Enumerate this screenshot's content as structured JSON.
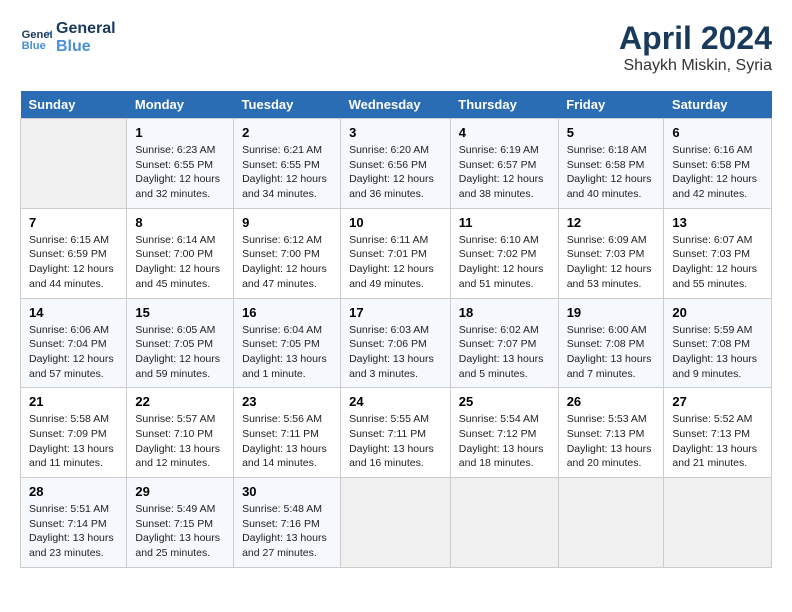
{
  "header": {
    "logo_line1": "General",
    "logo_line2": "Blue",
    "main_title": "April 2024",
    "subtitle": "Shaykh Miskin, Syria"
  },
  "calendar": {
    "weekdays": [
      "Sunday",
      "Monday",
      "Tuesday",
      "Wednesday",
      "Thursday",
      "Friday",
      "Saturday"
    ],
    "weeks": [
      [
        {
          "day": "",
          "info": ""
        },
        {
          "day": "1",
          "info": "Sunrise: 6:23 AM\nSunset: 6:55 PM\nDaylight: 12 hours\nand 32 minutes."
        },
        {
          "day": "2",
          "info": "Sunrise: 6:21 AM\nSunset: 6:55 PM\nDaylight: 12 hours\nand 34 minutes."
        },
        {
          "day": "3",
          "info": "Sunrise: 6:20 AM\nSunset: 6:56 PM\nDaylight: 12 hours\nand 36 minutes."
        },
        {
          "day": "4",
          "info": "Sunrise: 6:19 AM\nSunset: 6:57 PM\nDaylight: 12 hours\nand 38 minutes."
        },
        {
          "day": "5",
          "info": "Sunrise: 6:18 AM\nSunset: 6:58 PM\nDaylight: 12 hours\nand 40 minutes."
        },
        {
          "day": "6",
          "info": "Sunrise: 6:16 AM\nSunset: 6:58 PM\nDaylight: 12 hours\nand 42 minutes."
        }
      ],
      [
        {
          "day": "7",
          "info": "Sunrise: 6:15 AM\nSunset: 6:59 PM\nDaylight: 12 hours\nand 44 minutes."
        },
        {
          "day": "8",
          "info": "Sunrise: 6:14 AM\nSunset: 7:00 PM\nDaylight: 12 hours\nand 45 minutes."
        },
        {
          "day": "9",
          "info": "Sunrise: 6:12 AM\nSunset: 7:00 PM\nDaylight: 12 hours\nand 47 minutes."
        },
        {
          "day": "10",
          "info": "Sunrise: 6:11 AM\nSunset: 7:01 PM\nDaylight: 12 hours\nand 49 minutes."
        },
        {
          "day": "11",
          "info": "Sunrise: 6:10 AM\nSunset: 7:02 PM\nDaylight: 12 hours\nand 51 minutes."
        },
        {
          "day": "12",
          "info": "Sunrise: 6:09 AM\nSunset: 7:03 PM\nDaylight: 12 hours\nand 53 minutes."
        },
        {
          "day": "13",
          "info": "Sunrise: 6:07 AM\nSunset: 7:03 PM\nDaylight: 12 hours\nand 55 minutes."
        }
      ],
      [
        {
          "day": "14",
          "info": "Sunrise: 6:06 AM\nSunset: 7:04 PM\nDaylight: 12 hours\nand 57 minutes."
        },
        {
          "day": "15",
          "info": "Sunrise: 6:05 AM\nSunset: 7:05 PM\nDaylight: 12 hours\nand 59 minutes."
        },
        {
          "day": "16",
          "info": "Sunrise: 6:04 AM\nSunset: 7:05 PM\nDaylight: 13 hours\nand 1 minute."
        },
        {
          "day": "17",
          "info": "Sunrise: 6:03 AM\nSunset: 7:06 PM\nDaylight: 13 hours\nand 3 minutes."
        },
        {
          "day": "18",
          "info": "Sunrise: 6:02 AM\nSunset: 7:07 PM\nDaylight: 13 hours\nand 5 minutes."
        },
        {
          "day": "19",
          "info": "Sunrise: 6:00 AM\nSunset: 7:08 PM\nDaylight: 13 hours\nand 7 minutes."
        },
        {
          "day": "20",
          "info": "Sunrise: 5:59 AM\nSunset: 7:08 PM\nDaylight: 13 hours\nand 9 minutes."
        }
      ],
      [
        {
          "day": "21",
          "info": "Sunrise: 5:58 AM\nSunset: 7:09 PM\nDaylight: 13 hours\nand 11 minutes."
        },
        {
          "day": "22",
          "info": "Sunrise: 5:57 AM\nSunset: 7:10 PM\nDaylight: 13 hours\nand 12 minutes."
        },
        {
          "day": "23",
          "info": "Sunrise: 5:56 AM\nSunset: 7:11 PM\nDaylight: 13 hours\nand 14 minutes."
        },
        {
          "day": "24",
          "info": "Sunrise: 5:55 AM\nSunset: 7:11 PM\nDaylight: 13 hours\nand 16 minutes."
        },
        {
          "day": "25",
          "info": "Sunrise: 5:54 AM\nSunset: 7:12 PM\nDaylight: 13 hours\nand 18 minutes."
        },
        {
          "day": "26",
          "info": "Sunrise: 5:53 AM\nSunset: 7:13 PM\nDaylight: 13 hours\nand 20 minutes."
        },
        {
          "day": "27",
          "info": "Sunrise: 5:52 AM\nSunset: 7:13 PM\nDaylight: 13 hours\nand 21 minutes."
        }
      ],
      [
        {
          "day": "28",
          "info": "Sunrise: 5:51 AM\nSunset: 7:14 PM\nDaylight: 13 hours\nand 23 minutes."
        },
        {
          "day": "29",
          "info": "Sunrise: 5:49 AM\nSunset: 7:15 PM\nDaylight: 13 hours\nand 25 minutes."
        },
        {
          "day": "30",
          "info": "Sunrise: 5:48 AM\nSunset: 7:16 PM\nDaylight: 13 hours\nand 27 minutes."
        },
        {
          "day": "",
          "info": ""
        },
        {
          "day": "",
          "info": ""
        },
        {
          "day": "",
          "info": ""
        },
        {
          "day": "",
          "info": ""
        }
      ]
    ]
  }
}
